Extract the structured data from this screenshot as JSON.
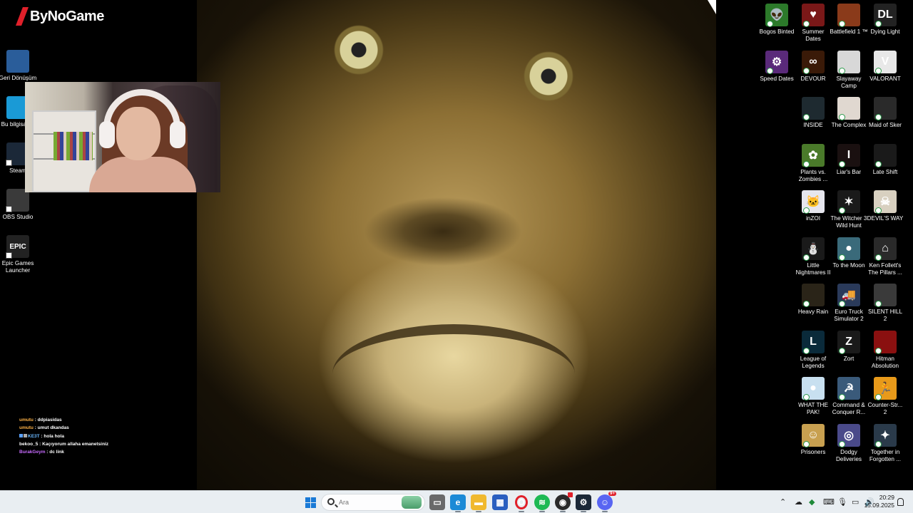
{
  "stream_overlay": {
    "logo_text": "ByNoGame",
    "logo_color": "#e0202a"
  },
  "chat": {
    "messages": [
      {
        "user": "umutu",
        "text": " : ddpiasidas",
        "user_color": "#ffb347"
      },
      {
        "user": "umutu",
        "text": " : umut dkandas",
        "user_color": "#ffb347"
      },
      {
        "user": "KE3T",
        "text": " : hola hola",
        "user_color": "#6ab8ff"
      },
      {
        "user": "bekoo_5",
        "text": " : Kaçıyorum allaha emanetsiniz",
        "user_color": "#ffffff"
      },
      {
        "user": "BurakGeym",
        "text": " : dc link",
        "user_color": "#c86cff"
      }
    ]
  },
  "desktop_left": [
    {
      "label": "Geri Dönüşüm",
      "icon": "recycle-bin-icon"
    },
    {
      "label": "Bu bilgisayar",
      "icon": "this-pc-icon"
    },
    {
      "label": "Steam",
      "icon": "steam-icon"
    },
    {
      "label": "OBS Studio",
      "icon": "obs-icon"
    },
    {
      "label": "Epic Games Launcher",
      "icon": "epic-games-icon",
      "icon_text": "EPIC"
    }
  ],
  "desktop_right": [
    {
      "label": "Bogos Binted",
      "color": "#2c7a2a",
      "glyph": "👽"
    },
    {
      "label": "Summer Dates",
      "color": "#7a1818",
      "glyph": "♥"
    },
    {
      "label": "Battlefield 1 ™",
      "color": "#8a3a1a",
      "glyph": ""
    },
    {
      "label": "Dying Light",
      "color": "#222222",
      "glyph": "DL"
    },
    {
      "label": "Speed Dates",
      "color": "#5a2a7a",
      "glyph": "⚙"
    },
    {
      "label": "DEVOUR",
      "color": "#3a1a08",
      "glyph": "∞"
    },
    {
      "label": "Slayaway Camp",
      "color": "#d8d8d8",
      "glyph": ""
    },
    {
      "label": "VALORANT",
      "color": "#e8e8e8",
      "glyph": "V"
    },
    {
      "label": "INSIDE",
      "color": "#1e2a30",
      "glyph": ""
    },
    {
      "label": "The Complex",
      "color": "#e0d8d0",
      "glyph": ""
    },
    {
      "label": "Maid of Sker",
      "color": "#2a2a2a",
      "glyph": ""
    },
    {
      "label": "Plants vs. Zombies ...",
      "color": "#4a7a2a",
      "glyph": "✿"
    },
    {
      "label": "Liar's Bar",
      "color": "#1a1010",
      "glyph": "I"
    },
    {
      "label": "Late Shift",
      "color": "#1a1a1a",
      "glyph": ""
    },
    {
      "label": "inZOI",
      "color": "#e6e6ee",
      "glyph": "🐱"
    },
    {
      "label": "The Witcher 3 Wild Hunt",
      "color": "#1a1a1a",
      "glyph": "✶"
    },
    {
      "label": "DEVIL'S WAY",
      "color": "#d8d0c0",
      "glyph": "☠"
    },
    {
      "label": "Little Nightmares II",
      "color": "#1a1a1a",
      "glyph": "⛄"
    },
    {
      "label": "To the Moon",
      "color": "#3a6a7a",
      "glyph": "●"
    },
    {
      "label": "Ken Follett's The Pillars ...",
      "color": "#2a2a2a",
      "glyph": "⌂"
    },
    {
      "label": "Heavy Rain",
      "color": "#2a2418",
      "glyph": ""
    },
    {
      "label": "Euro Truck Simulator 2",
      "color": "#2a3a5a",
      "glyph": "🚚"
    },
    {
      "label": "SILENT HILL 2",
      "color": "#3a3a3a",
      "glyph": ""
    },
    {
      "label": "League of Legends",
      "color": "#0a2a3a",
      "glyph": "L"
    },
    {
      "label": "Zort",
      "color": "#1a1a1a",
      "glyph": "Z"
    },
    {
      "label": "Hitman Absolution",
      "color": "#8a1010",
      "glyph": ""
    },
    {
      "label": "WHAT THE PAK!",
      "color": "#c8e0f0",
      "glyph": "●"
    },
    {
      "label": "Command & Conquer R...",
      "color": "#3a5a7a",
      "glyph": "☭"
    },
    {
      "label": "Counter-Str... 2",
      "color": "#e89a1a",
      "glyph": "🏃"
    },
    {
      "label": "Prisoners",
      "color": "#c8a050",
      "glyph": "☺"
    },
    {
      "label": "Dodgy Deliveries",
      "color": "#4a4a8a",
      "glyph": "◎"
    },
    {
      "label": "Together in Forgotten ...",
      "color": "#2a3a4a",
      "glyph": "✦"
    }
  ],
  "taskbar": {
    "search_placeholder": "Ara",
    "apps": [
      {
        "name": "task-view",
        "color": "#6a6a6a",
        "glyph": "▭"
      },
      {
        "name": "edge",
        "color": "#1c8ad6",
        "glyph": "e"
      },
      {
        "name": "file-explorer",
        "color": "#f0b92e",
        "glyph": "▬"
      },
      {
        "name": "microsoft-store",
        "color": "#2a5fc0",
        "glyph": "▦"
      },
      {
        "name": "opera",
        "color": "#e0202a",
        "glyph": "O"
      },
      {
        "name": "spotify",
        "color": "#1db954",
        "glyph": "≋"
      },
      {
        "name": "obs",
        "color": "#2a2a2a",
        "glyph": "◉"
      },
      {
        "name": "steam",
        "color": "#1b2838",
        "glyph": "⚙"
      },
      {
        "name": "discord",
        "color": "#5865f2",
        "glyph": "☺"
      }
    ],
    "discord_badge": "9+",
    "time": "20:29",
    "date": "15.09.2025"
  }
}
